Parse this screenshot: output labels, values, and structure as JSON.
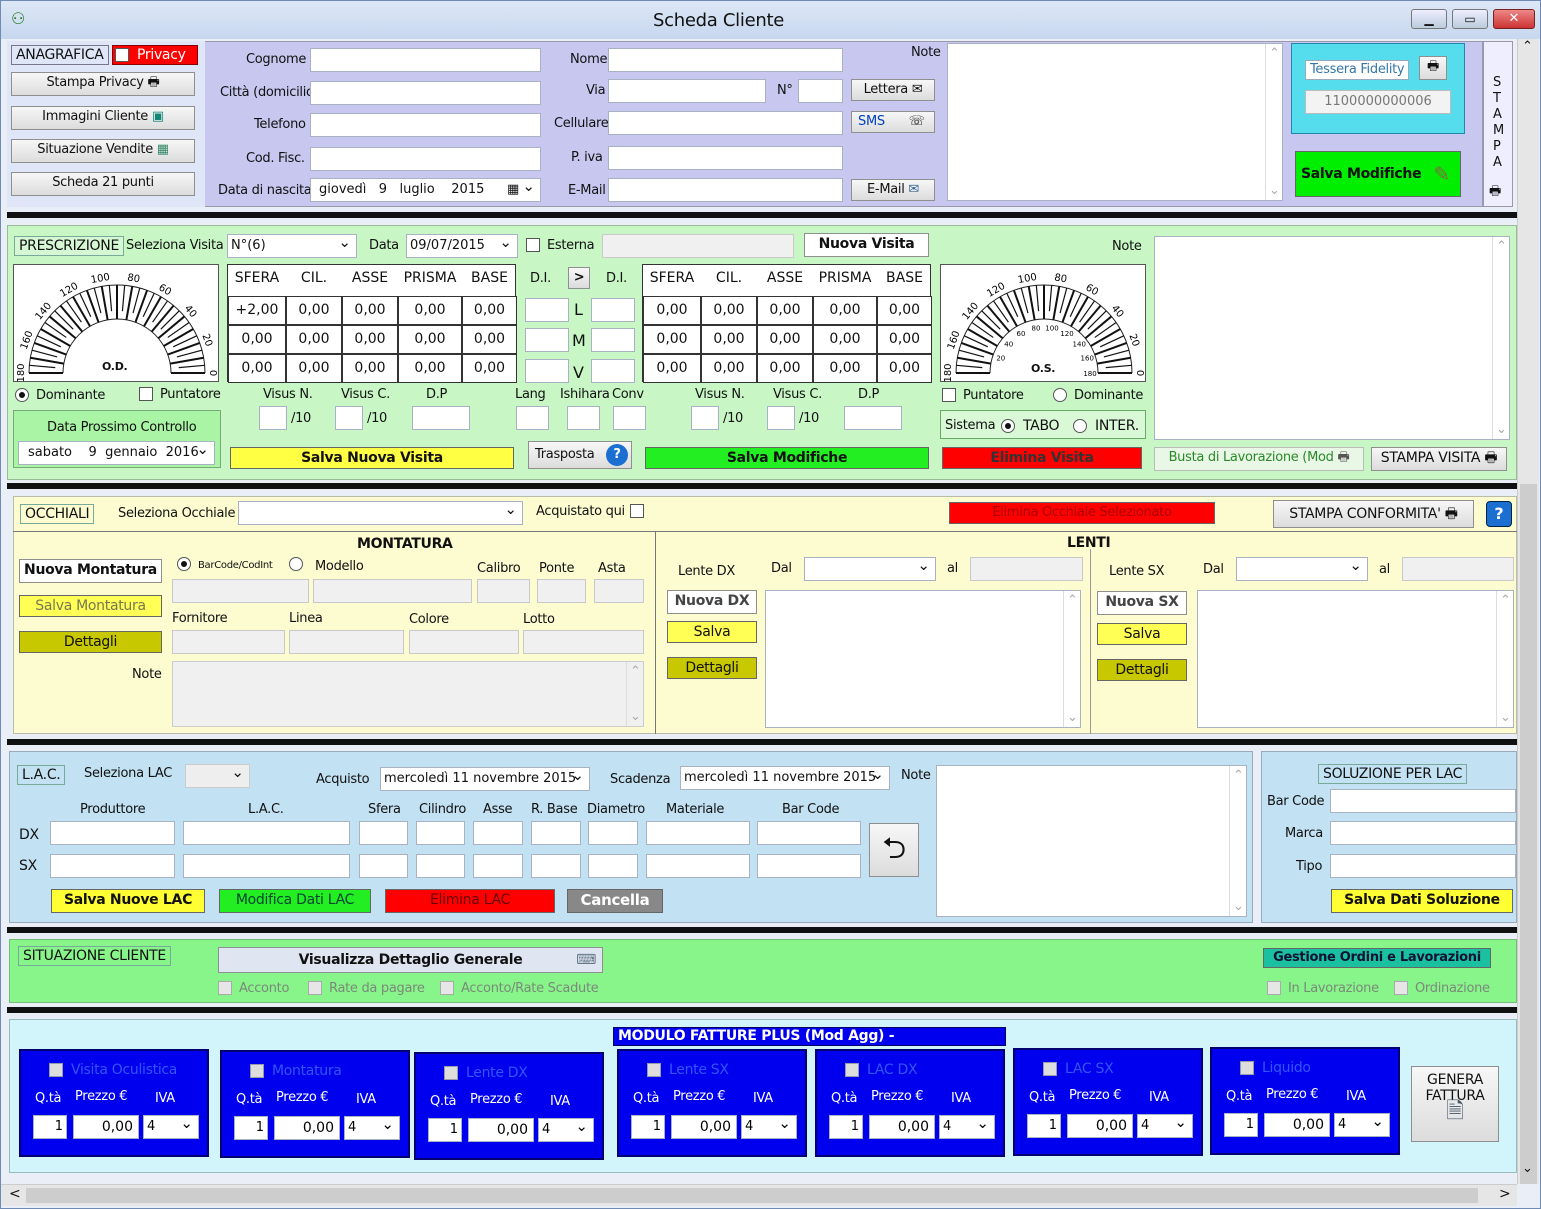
{
  "window": {
    "title": "Scheda Cliente",
    "scroll_left": "<",
    "scroll_right": ">"
  },
  "anagrafica": {
    "label": "ANAGRAFICA",
    "privacy": "Privacy",
    "buttons": [
      "Stampa Privacy",
      "Immagini Cliente",
      "Situazione Vendite",
      "Scheda 21 punti"
    ],
    "fields": {
      "cognome": "Cognome",
      "citta": "Città (domicilio)",
      "telefono": "Telefono",
      "codfisc": "Cod. Fisc.",
      "nascita": "Data di nascita",
      "nome": "Nome",
      "via": "Via",
      "numero": "N°",
      "cellulare": "Cellulare",
      "piva": "P. iva",
      "email": "E-Mail",
      "note": "Note"
    },
    "birth": {
      "day": "giovedì",
      "d": "9",
      "month": "luglio",
      "year": "2015"
    },
    "lettera": "Lettera",
    "sms": "SMS",
    "email_btn": "E-Mail",
    "tessera": "Tessera Fidelity",
    "tessera_num": "1100000000006",
    "salva": "Salva Modifiche",
    "stampa_letters": [
      "S",
      "T",
      "A",
      "M",
      "P",
      "A"
    ]
  },
  "prescrizione": {
    "label": "PRESCRIZIONE",
    "seleziona_visita": "Seleziona Visita",
    "visita_value": "N°(6)",
    "data_label": "Data",
    "data_value": "09/07/2015",
    "esterna": "Esterna",
    "nuova_visita": "Nuova Visita",
    "note": "Note",
    "headers": [
      "SFERA",
      "CIL.",
      "ASSE",
      "PRISMA",
      "BASE"
    ],
    "od_rows": [
      [
        "+2,00",
        "0,00",
        "0,00",
        "0,00",
        "0,00"
      ],
      [
        "0,00",
        "0,00",
        "0,00",
        "0,00",
        "0,00"
      ],
      [
        "0,00",
        "0,00",
        "0,00",
        "0,00",
        "0,00"
      ]
    ],
    "os_rows": [
      [
        "0,00",
        "0,00",
        "0,00",
        "0,00",
        "0,00"
      ],
      [
        "0,00",
        "0,00",
        "0,00",
        "0,00",
        "0,00"
      ],
      [
        "0,00",
        "0,00",
        "0,00",
        "0,00",
        "0,00"
      ]
    ],
    "di": "D.I.",
    "arrow": ">",
    "lmv": [
      "L",
      "M",
      "V"
    ],
    "od": "O.D.",
    "os": "O.S.",
    "dial_labels": [
      "180",
      "160",
      "140",
      "120",
      "100",
      "80",
      "60",
      "40",
      "20",
      "0"
    ],
    "dial_inner": [
      "20",
      "40",
      "60",
      "80",
      "100",
      "120",
      "140",
      "160",
      "180"
    ],
    "dominante": "Dominante",
    "puntatore": "Puntatore",
    "visus_n": "Visus N.",
    "visus_c": "Visus C.",
    "dp": "D.P",
    "per10": "/10",
    "lang": "Lang",
    "ishihara": "Ishihara",
    "conv": "Conv",
    "prossimo": "Data Prossimo Controllo",
    "prossimo_date": {
      "day": "sabato",
      "d": "9",
      "month": "gennaio",
      "year": "2016"
    },
    "salva_nuova": "Salva Nuova Visita",
    "trasposta": "Trasposta",
    "salva_modifiche": "Salva Modifiche",
    "elimina": "Elimina Visita",
    "sistema": "Sistema",
    "tabo": "TABO",
    "inter": "INTER.",
    "busta": "Busta di Lavorazione (Mod",
    "stampa_visita": "STAMPA VISITA"
  },
  "occhiali": {
    "label": "OCCHIALI",
    "seleziona": "Seleziona Occhiale",
    "acquistato": "Acquistato qui",
    "elimina": "Elimina Occhiale Selezionato",
    "stampa_conf": "STAMPA CONFORMITA'",
    "montatura": "MONTATURA",
    "nuova_montatura": "Nuova Montatura",
    "salva_montatura": "Salva Montatura",
    "dettagli": "Dettagli",
    "barcode": "BarCode/CodInt",
    "modello": "Modello",
    "calibro": "Calibro",
    "ponte": "Ponte",
    "asta": "Asta",
    "fornitore": "Fornitore",
    "linea": "Linea",
    "colore": "Colore",
    "lotto": "Lotto",
    "note": "Note",
    "lenti": "LENTI",
    "lente_dx": "Lente DX",
    "lente_sx": "Lente SX",
    "dal": "Dal",
    "al": "al",
    "nuova_dx": "Nuova DX",
    "nuova_sx": "Nuova SX",
    "salva": "Salva"
  },
  "lac": {
    "label": "L.A.C.",
    "seleziona": "Seleziona LAC",
    "acquisto": "Acquisto",
    "acquisto_date": "mercoledì 11 novembre 2015",
    "scadenza": "Scadenza",
    "scadenza_date": "mercoledì 11 novembre 2015",
    "note": "Note",
    "cols": [
      "Produttore",
      "L.A.C.",
      "Sfera",
      "Cilindro",
      "Asse",
      "R. Base",
      "Diametro",
      "Materiale",
      "Bar Code"
    ],
    "dx": "DX",
    "sx": "SX",
    "salva": "Salva Nuove LAC",
    "modifica": "Modifica Dati LAC",
    "elimina": "Elimina LAC",
    "cancella": "Cancella",
    "soluzione": "SOLUZIONE PER LAC",
    "barcode": "Bar Code",
    "marca": "Marca",
    "tipo": "Tipo",
    "salva_sol": "Salva Dati Soluzione"
  },
  "situazione": {
    "label": "SITUAZIONE CLIENTE",
    "dettaglio": "Visualizza Dettaglio Generale",
    "acconto": "Acconto",
    "rate": "Rate da pagare",
    "scadute": "Acconto/Rate Scadute",
    "gestione": "Gestione Ordini e Lavorazioni",
    "lavorazione": "In Lavorazione",
    "ordinazione": "Ordinazione"
  },
  "fatture": {
    "title": "MODULO FATTURE PLUS (Mod Agg) -",
    "qta": "Q.tà",
    "prezzo": "Prezzo €",
    "iva": "IVA",
    "items": [
      {
        "name": "Visita Oculistica",
        "qty": "1",
        "price": "0,00",
        "iva": "4"
      },
      {
        "name": "Montatura",
        "qty": "1",
        "price": "0,00",
        "iva": "4"
      },
      {
        "name": "Lente DX",
        "qty": "1",
        "price": "0,00",
        "iva": "4"
      },
      {
        "name": "Lente SX",
        "qty": "1",
        "price": "0,00",
        "iva": "4"
      },
      {
        "name": "LAC DX",
        "qty": "1",
        "price": "0,00",
        "iva": "4"
      },
      {
        "name": "LAC SX",
        "qty": "1",
        "price": "0,00",
        "iva": "4"
      },
      {
        "name": "Liquido",
        "qty": "1",
        "price": "0,00",
        "iva": "4"
      }
    ],
    "genera": "GENERA FATTURA"
  }
}
